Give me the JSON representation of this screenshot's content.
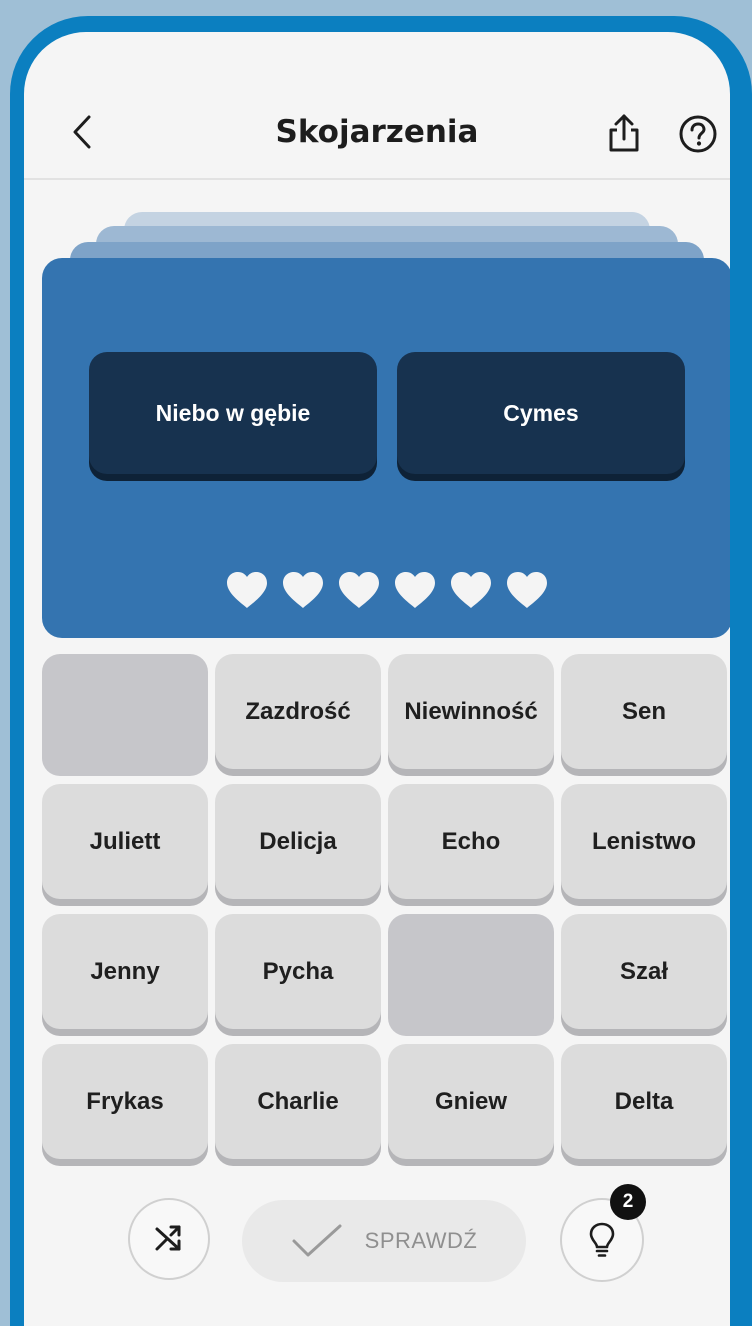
{
  "header": {
    "title": "Skojarzenia"
  },
  "categories": [
    {
      "label": "Niebo w gębie"
    },
    {
      "label": "Cymes"
    }
  ],
  "lives": {
    "remaining": 6,
    "total": 6
  },
  "grid": {
    "tiles": [
      {
        "label": "",
        "state": "empty"
      },
      {
        "label": "Zazdrość",
        "state": "active"
      },
      {
        "label": "Niewinność",
        "state": "active"
      },
      {
        "label": "Sen",
        "state": "active"
      },
      {
        "label": "Juliett",
        "state": "active"
      },
      {
        "label": "Delicja",
        "state": "active"
      },
      {
        "label": "Echo",
        "state": "active"
      },
      {
        "label": "Lenistwo",
        "state": "active"
      },
      {
        "label": "Jenny",
        "state": "active"
      },
      {
        "label": "Pycha",
        "state": "active"
      },
      {
        "label": "",
        "state": "empty"
      },
      {
        "label": "Szał",
        "state": "active"
      },
      {
        "label": "Frykas",
        "state": "active"
      },
      {
        "label": "Charlie",
        "state": "active"
      },
      {
        "label": "Gniew",
        "state": "active"
      },
      {
        "label": "Delta",
        "state": "active"
      }
    ]
  },
  "controls": {
    "check_label": "SPRAWDŹ",
    "hint_count": "2"
  },
  "colors": {
    "board": "#3474b0",
    "category_tile": "#17324f",
    "tile": "#dcdcdc",
    "frame": "#0b7fc0"
  },
  "icons": {
    "back": "chevron-left-icon",
    "share": "share-icon",
    "help": "help-circle-icon",
    "heart": "heart-icon",
    "shuffle": "shuffle-icon",
    "check": "checkmark-icon",
    "hint": "lightbulb-icon"
  }
}
